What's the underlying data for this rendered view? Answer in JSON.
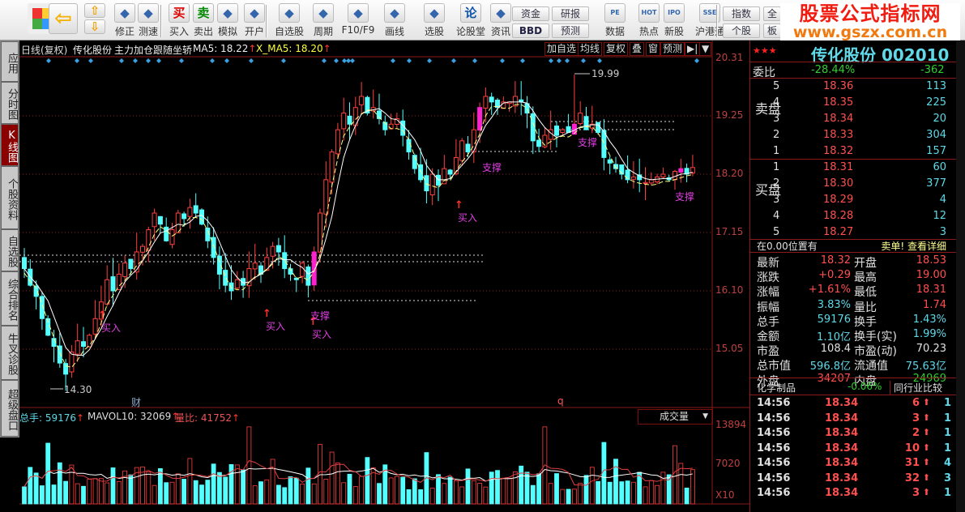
{
  "toolbar": {
    "buttons": [
      {
        "label": "",
        "icon": "windows-logo-icon"
      },
      {
        "label": "",
        "icon": "back-arrow-icon"
      },
      {
        "label": "修正",
        "icon": "refresh-icon"
      },
      {
        "label": "测速",
        "icon": "clock-icon"
      },
      {
        "label": "买入",
        "icon": "buy-icon",
        "glyph": "买"
      },
      {
        "label": "卖出",
        "icon": "sell-icon",
        "glyph": "卖"
      },
      {
        "label": "模拟",
        "icon": "gavel-icon"
      },
      {
        "label": "开户",
        "icon": "lock-icon"
      },
      {
        "label": "自选股",
        "icon": "folder-star-icon"
      },
      {
        "label": "周期",
        "icon": "clock-period-icon"
      },
      {
        "label": "F10/F9",
        "icon": "f10-icon"
      },
      {
        "label": "画线",
        "icon": "pencil-icon"
      },
      {
        "label": "选股",
        "icon": "radar-icon"
      },
      {
        "label": "论股堂",
        "icon": "forum-icon",
        "glyph": "论"
      },
      {
        "label": "资讯",
        "icon": "document-icon"
      },
      {
        "label": "数据",
        "icon": "pe-icon",
        "glyph": "PE"
      },
      {
        "label": "热点",
        "icon": "hot-icon",
        "glyph": "HOT"
      },
      {
        "label": "新股",
        "icon": "ipo-icon",
        "glyph": "IPO"
      },
      {
        "label": "沪港通",
        "icon": "sse-hkex-icon",
        "glyph": "SSE"
      }
    ],
    "small_buttons": [
      "资金",
      "BBD",
      "研报",
      "预测",
      "指数",
      "个股",
      "全",
      "板"
    ]
  },
  "watermark": {
    "line1": "股票公式指标网",
    "line2": "www.gszx.com.cn"
  },
  "sidebar": {
    "tabs": [
      "应用",
      "分时图",
      "K线图",
      "个股资料",
      "自选股",
      "综合排名",
      "牛叉诊股",
      "超级盘口"
    ],
    "active": 2
  },
  "chart_header": {
    "period": "日线(复权)",
    "stock": "传化股份",
    "indicator": "主力加仓跟随坐轿",
    "ma5": "MA5: 18.22",
    "xma5": "X_MA5: 18.20",
    "buttons": [
      "加自选",
      "均线",
      "复权",
      "叠",
      "窗",
      "预测",
      "▶|",
      "▼"
    ]
  },
  "price_axis": [
    "20.31",
    "19.25",
    "18.20",
    "17.15",
    "16.10",
    "15.05"
  ],
  "annotations": {
    "low": "14.30",
    "high": "19.99",
    "buy": "买入",
    "support": "支撑",
    "events": [
      "财",
      "q"
    ]
  },
  "volume_header": {
    "total": "总手: 59176",
    "mavol": "MAVOL10: 32069",
    "liangbi": "量比: 41752",
    "selector": "成交量"
  },
  "volume_axis": [
    "13894",
    "7020",
    "X10"
  ],
  "chart_data": {
    "type": "candlestick",
    "closes": [
      16.5,
      16.2,
      16.0,
      15.6,
      15.3,
      15.1,
      14.8,
      14.6,
      15.0,
      15.2,
      15.1,
      15.3,
      15.6,
      15.9,
      16.3,
      16.1,
      16.4,
      16.6,
      16.5,
      16.8,
      16.9,
      17.2,
      17.5,
      17.3,
      17.0,
      17.2,
      17.5,
      17.4,
      17.6,
      17.5,
      17.3,
      17.0,
      16.7,
      16.4,
      16.2,
      16.1,
      16.3,
      16.2,
      16.5,
      16.6,
      16.4,
      16.7,
      16.9,
      16.8,
      16.5,
      16.4,
      16.3,
      16.6,
      16.2,
      16.8,
      17.5,
      18.1,
      18.6,
      19.0,
      19.3,
      19.1,
      19.4,
      19.6,
      19.3,
      19.4,
      19.2,
      19.0,
      19.1,
      19.2,
      18.9,
      18.6,
      18.3,
      18.1,
      17.9,
      18.2,
      18.0,
      18.3,
      18.2,
      18.5,
      18.8,
      18.6,
      19.0,
      19.4,
      19.6,
      19.5,
      19.4,
      19.5,
      19.5,
      19.6,
      19.5,
      19.3,
      18.8,
      18.7,
      18.9,
      19.0,
      18.9,
      19.0,
      18.95,
      19.1,
      19.3,
      19.0,
      19.1,
      18.95,
      18.5,
      18.4,
      18.3,
      18.2,
      18.1,
      18.15,
      18.1,
      18.05,
      18.1,
      18.15,
      18.2,
      18.1,
      18.25,
      18.3,
      18.2,
      18.32
    ],
    "ylim": [
      14.0,
      20.31
    ]
  },
  "quote": {
    "title": "传化股份 002010",
    "weibi_label": "委比",
    "weibi": "-28.44%",
    "weicha": "-362",
    "sell_label": "卖盘",
    "buy_label": "买盘",
    "sell": [
      {
        "lvl": "5",
        "price": "18.36",
        "vol": "113"
      },
      {
        "lvl": "4",
        "price": "18.35",
        "vol": "225"
      },
      {
        "lvl": "3",
        "price": "18.34",
        "vol": "20"
      },
      {
        "lvl": "2",
        "price": "18.33",
        "vol": "304"
      },
      {
        "lvl": "1",
        "price": "18.32",
        "vol": "157"
      }
    ],
    "buy": [
      {
        "lvl": "1",
        "price": "18.31",
        "vol": "60"
      },
      {
        "lvl": "2",
        "price": "18.30",
        "vol": "377"
      },
      {
        "lvl": "3",
        "price": "18.29",
        "vol": "4"
      },
      {
        "lvl": "4",
        "price": "18.28",
        "vol": "12"
      },
      {
        "lvl": "5",
        "price": "18.27",
        "vol": "3"
      }
    ],
    "position_note": "在0.00位置有",
    "detail_link": "卖单! 查看详细",
    "stats": [
      [
        "最新",
        "18.32",
        "red",
        "开盘",
        "18.53",
        "red"
      ],
      [
        "涨跌",
        "+0.29",
        "red",
        "最高",
        "19.00",
        "red"
      ],
      [
        "涨幅",
        "+1.61%",
        "red",
        "最低",
        "18.31",
        "red"
      ],
      [
        "振幅",
        "3.83%",
        "cy",
        "量比",
        "1.74",
        "red"
      ],
      [
        "总手",
        "59176",
        "cy",
        "换手",
        "1.43%",
        "cy"
      ],
      [
        "金额",
        "1.10亿",
        "cy",
        "换手(实)",
        "1.99%",
        "cy"
      ],
      [
        "市盈",
        "108.4",
        "wh",
        "市盈(动)",
        "70.23",
        "wh"
      ],
      [
        "总市值",
        "596.8亿",
        "cy",
        "流通值",
        "75.63亿",
        "cy"
      ],
      [
        "外盘",
        "34207",
        "red",
        "内盘",
        "24969",
        "gr"
      ]
    ],
    "industry": "化学制品",
    "industry_change": "-0.06%",
    "compare": "同行业比较",
    "ticks": [
      {
        "time": "14:56",
        "price": "18.34",
        "vol": "6",
        "n": "1"
      },
      {
        "time": "14:56",
        "price": "18.34",
        "vol": "3",
        "n": "1"
      },
      {
        "time": "14:56",
        "price": "18.34",
        "vol": "2",
        "n": "1"
      },
      {
        "time": "14:56",
        "price": "18.34",
        "vol": "10",
        "n": "1"
      },
      {
        "time": "14:56",
        "price": "18.34",
        "vol": "31",
        "n": "4"
      },
      {
        "time": "14:56",
        "price": "18.34",
        "vol": "32",
        "n": "3"
      },
      {
        "time": "14:56",
        "price": "18.34",
        "vol": "3",
        "n": "1"
      }
    ]
  },
  "colors": {
    "up": "#ff4040",
    "down": "#54ffff",
    "support": "#e040e0",
    "grid": "#8b1a1a",
    "bg": "#000000"
  }
}
